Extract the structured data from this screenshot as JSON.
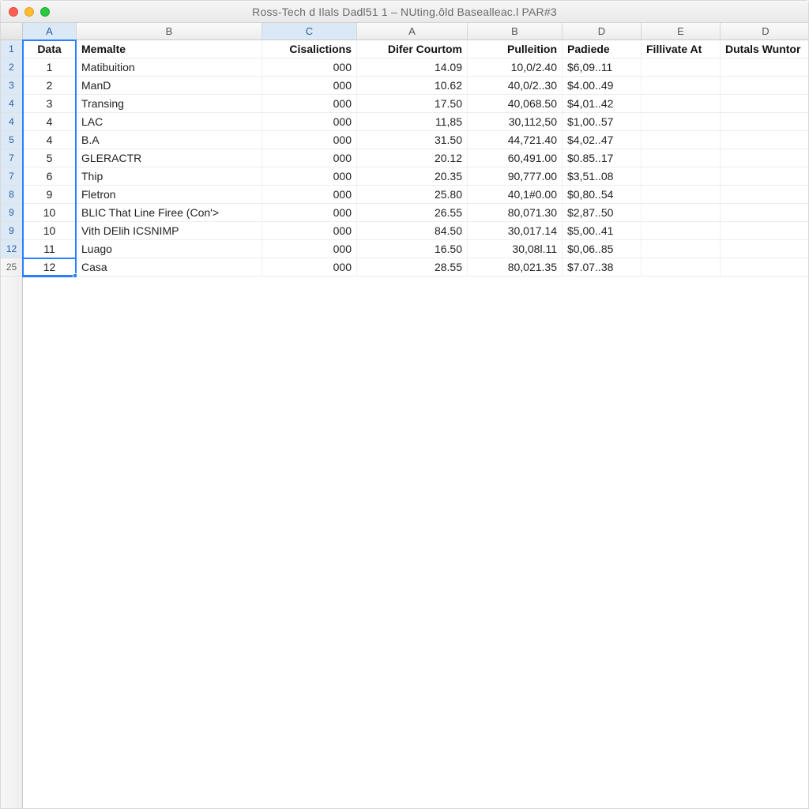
{
  "window": {
    "title": "Ross-Tech d Ilals Dadl51 1 – NUting.ôld Basealleac.l PAR#3"
  },
  "col_letters": [
    "A",
    "B",
    "C",
    "A",
    "B",
    "D",
    "E",
    "D"
  ],
  "row_numbers_left": [
    "1",
    "2",
    "3",
    "4",
    "4",
    "5",
    "7",
    "7",
    "8",
    "9",
    "9",
    "12",
    "25"
  ],
  "headers": {
    "c0": "Data",
    "c1": "Memalte",
    "c2": "Cisalictions",
    "c3": "Difer Courtom",
    "c4": "Pulleition",
    "c5": "Padiede",
    "c6": "Fillivate At",
    "c7": "Dutals Wuntor"
  },
  "rows": [
    {
      "a": "1",
      "b": "Matibuition",
      "c": "000",
      "d": "14.09",
      "e": "10,0/2.40",
      "f": "$6,09..11"
    },
    {
      "a": "2",
      "b": "ManD",
      "c": "000",
      "d": "10.62",
      "e": "40,0/2..30",
      "f": "$4.00..49"
    },
    {
      "a": "3",
      "b": "Transing",
      "c": "000",
      "d": "17.50",
      "e": "40,068.50",
      "f": "$4,01..42"
    },
    {
      "a": "4",
      "b": "LAC",
      "c": "000",
      "d": "11,85",
      "e": "30,112,50",
      "f": "$1,00..57"
    },
    {
      "a": "4",
      "b": "B.A",
      "c": "000",
      "d": "31.50",
      "e": "44,721.40",
      "f": "$4,02..47"
    },
    {
      "a": "5",
      "b": "GLERACTR",
      "c": "000",
      "d": "20.12",
      "e": "60,491.00",
      "f": "$0.85..17"
    },
    {
      "a": "6",
      "b": "Thip",
      "c": "000",
      "d": "20.35",
      "e": "90,777.00",
      "f": "$3,51..08"
    },
    {
      "a": "9",
      "b": "Fletron",
      "c": "000",
      "d": "25.80",
      "e": "40,1#0.00",
      "f": "$0,80..54"
    },
    {
      "a": "10",
      "b": "BLIC That Line Firee (Con'>",
      "c": "000",
      "d": "26.55",
      "e": "80,071.30",
      "f": "$2,87..50"
    },
    {
      "a": "10",
      "b": "Vith DElih ICSNIMP",
      "c": "000",
      "d": "84.50",
      "e": "30,017.14",
      "f": "$5,00..41"
    },
    {
      "a": "11",
      "b": "Luago",
      "c": "000",
      "d": "16.50",
      "e": "30,08l.11",
      "f": "$0,06..85"
    },
    {
      "a": "12",
      "b": "Casa",
      "c": "000",
      "d": "28.55",
      "e": "80,021.35",
      "f": "$7.07..38"
    }
  ]
}
